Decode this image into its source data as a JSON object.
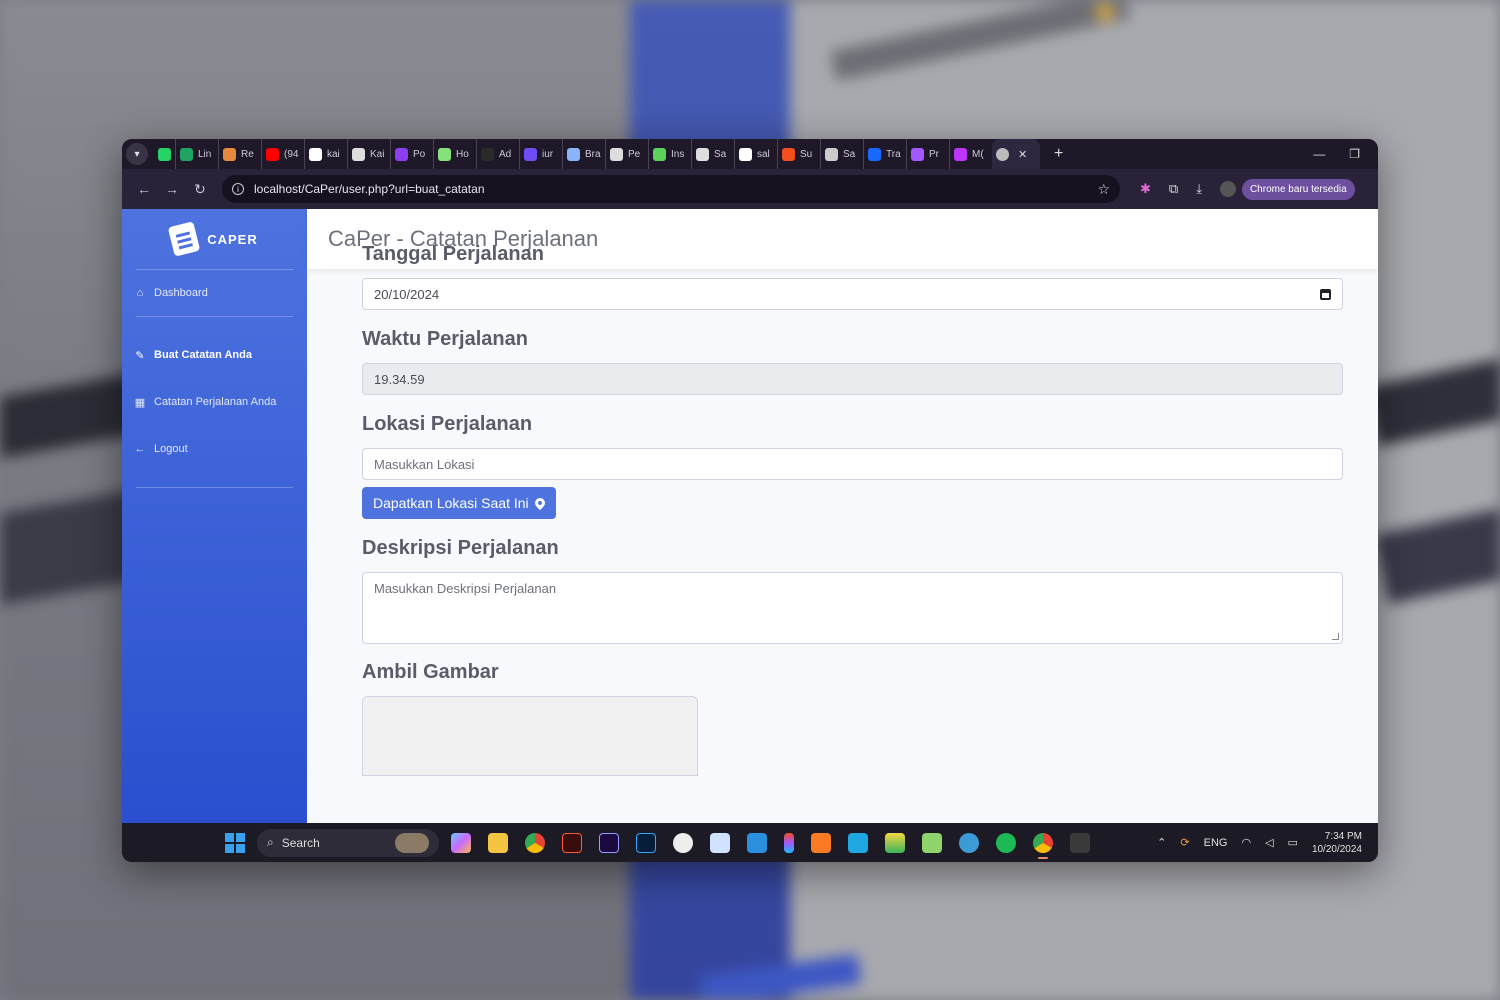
{
  "browser": {
    "tabs": [
      {
        "label": "",
        "icon": "whatsapp-icon",
        "color": "#25d366"
      },
      {
        "label": "Lin",
        "icon": "sheets-icon",
        "color": "#1fa463"
      },
      {
        "label": "Re",
        "icon": "reddit-icon",
        "color": "#e58a3c"
      },
      {
        "label": "(94",
        "icon": "youtube-icon",
        "color": "#ff0000"
      },
      {
        "label": "kai",
        "icon": "github-icon",
        "color": "#ffffff"
      },
      {
        "label": "Kai",
        "icon": "kaggle-icon",
        "color": "#dddddd"
      },
      {
        "label": "Po",
        "icon": "s-icon",
        "color": "#8b3ff0"
      },
      {
        "label": "Ho",
        "icon": "hostinger-icon",
        "color": "#86e07c"
      },
      {
        "label": "Ad",
        "icon": "adobe-icon",
        "color": "#2a2a2a"
      },
      {
        "label": "iur",
        "icon": "brackets-icon",
        "color": "#6f4cf5"
      },
      {
        "label": "Bra",
        "icon": "brave-icon",
        "color": "#8ab4f8"
      },
      {
        "label": "Pe",
        "icon": "openai-icon",
        "color": "#dddddd"
      },
      {
        "label": "Ins",
        "icon": "clover-icon",
        "color": "#5cd25c"
      },
      {
        "label": "Sa",
        "icon": "kaggle-icon",
        "color": "#dddddd"
      },
      {
        "label": "sal",
        "icon": "github-icon",
        "color": "#ffffff"
      },
      {
        "label": "Su",
        "icon": "figma-icon",
        "color": "#f24e1e"
      },
      {
        "label": "Sa",
        "icon": "globe-icon",
        "color": "#cccccc"
      },
      {
        "label": "Tra",
        "icon": "behance-icon",
        "color": "#1769ff"
      },
      {
        "label": "Pr",
        "icon": "figma-icon",
        "color": "#a259ff"
      },
      {
        "label": "M(",
        "icon": "vite-icon",
        "color": "#bd34fe"
      }
    ],
    "url": "localhost/CaPer/user.php?url=buat_catatan",
    "update_pill": "Chrome baru tersedia"
  },
  "sidebar": {
    "brand": "CAPER",
    "items": [
      {
        "label": "Dashboard",
        "icon": "home-icon",
        "active": false
      },
      {
        "label": "Buat Catatan Anda",
        "icon": "edit-icon",
        "active": true
      },
      {
        "label": "Catatan Perjalanan Anda",
        "icon": "table-icon",
        "active": false
      },
      {
        "label": "Logout",
        "icon": "arrow-left-icon",
        "active": false
      }
    ]
  },
  "page": {
    "title": "CaPer - Catatan Perjalanan"
  },
  "form": {
    "date_label": "Tanggal Perjalanan",
    "date_value": "20/10/2024",
    "time_label": "Waktu Perjalanan",
    "time_value": "19.34.59",
    "location_label": "Lokasi Perjalanan",
    "location_placeholder": "Masukkan Lokasi",
    "location_button": "Dapatkan Lokasi Saat Ini",
    "desc_label": "Deskripsi Perjalanan",
    "desc_placeholder": "Masukkan Deskripsi Perjalanan",
    "image_label": "Ambil Gambar"
  },
  "taskbar": {
    "search_label": "Search",
    "language": "ENG",
    "time": "7:34 PM",
    "date": "10/20/2024"
  },
  "colors": {
    "primary": "#4e73df",
    "sidebar_bottom": "#2a4fcf"
  }
}
